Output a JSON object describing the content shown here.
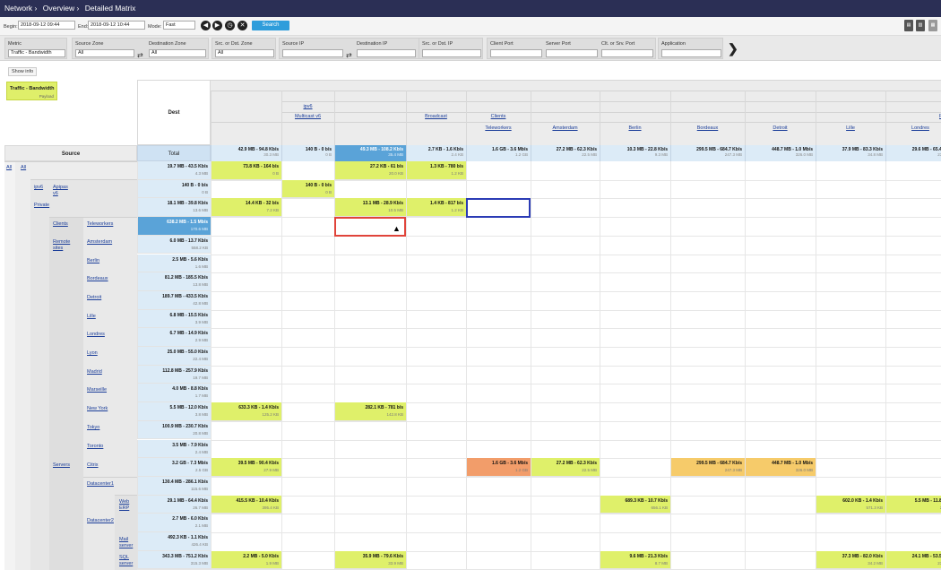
{
  "topbar": {
    "crumbs": [
      "Network ›",
      "Overview ›",
      "Detailed Matrix"
    ]
  },
  "filters": {
    "begin_label": "Begin:",
    "begin": "2018-09-12 09:44",
    "end_label": "End:",
    "end": "2018-09-12 10:44",
    "mode_label": "Mode:",
    "mode": "Fast",
    "search": "Search"
  },
  "facets": [
    {
      "title": "Metric",
      "value": "Traffic - Bandwidth"
    },
    {
      "title": "Source Zone",
      "value": "All"
    },
    {
      "title": "Destination Zone",
      "value": "All"
    },
    {
      "title": "Src. or Dst. Zone",
      "value": "All"
    },
    {
      "title": "Source IP",
      "value": ""
    },
    {
      "title": "Destination IP",
      "value": ""
    },
    {
      "title": "Src. or Dst. IP",
      "value": ""
    },
    {
      "title": "Client Port",
      "value": ""
    },
    {
      "title": "Server Port",
      "value": ""
    },
    {
      "title": "Clt. or Srv. Port",
      "value": ""
    },
    {
      "title": "Application",
      "value": ""
    }
  ],
  "show_info": "Show info",
  "legend": {
    "title": "Traffic - Bandwidth",
    "sub": "Payload"
  },
  "labels": {
    "dest": "Dest",
    "source": "Source",
    "total": "Total"
  },
  "dest_groups": {
    "ipv6": "ipv6",
    "multicast": "Multicast v6",
    "broadcast": "Broadcast",
    "clients": "Clients",
    "r": "R"
  },
  "columns": [
    "Teleworkers",
    "Amsterdam",
    "Berlin",
    "Bordeaux",
    "Detroit",
    "Lille",
    "Londres"
  ],
  "col_totals": [
    {
      "v": "42.9 MB - 94.8 Kb/s",
      "g": "30.3 MB"
    },
    {
      "v": "140 B - 0 b/s",
      "g": "0 B"
    },
    {
      "v": "49.3 MB - 108.2 Kb/s",
      "g": "35.4 MB"
    },
    {
      "v": "2.7 KB - 1.6 Kb/s",
      "g": "2.4 KB"
    },
    {
      "v": "1.6 GB - 3.6 Mb/s",
      "g": "1.2 GB"
    },
    {
      "v": "27.2 MB - 62.3 Kb/s",
      "g": "22.5 MB"
    },
    {
      "v": "10.3 MB - 22.8 Kb/s",
      "g": "9.3 MB"
    },
    {
      "v": "299.5 MB - 684.7 Kb/s",
      "g": "247.3 MB"
    },
    {
      "v": "448.7 MB - 1.0 Mb/s",
      "g": "326.0 MB"
    },
    {
      "v": "37.9 MB - 83.3 Kb/s",
      "g": "34.8 MB"
    },
    {
      "v": "29.6 MB - 65.4 Kb/s",
      "g": "23.9 MB"
    }
  ],
  "src_labels": {
    "all1": "All",
    "all2": "All",
    "ipv6": "ipv6",
    "apipa": "Apipas v6",
    "private": "Private",
    "clients": "Clients",
    "teleworkers": "Teleworkers",
    "remote": "Remote sites",
    "servers": "Servers",
    "citrix": "Citrix",
    "dc1": "Datacenter1",
    "web": "Web ERP",
    "dc2": "Datacenter2",
    "mail": "Mail server",
    "sql": "SQL server"
  },
  "rows": [
    {
      "name": "",
      "total": {
        "v": "19.7 MB - 43.5 Kb/s",
        "g": "4.3 MB"
      }
    },
    {
      "name": "",
      "total": {
        "v": "140 B - 0 b/s",
        "g": "0 B"
      }
    },
    {
      "name": "",
      "total": {
        "v": "18.1 MB - 39.8 Kb/s",
        "g": "13.6 MB"
      }
    },
    {
      "name": "",
      "total": {
        "v": "638.2 MB - 1.5 Mb/s",
        "g": "170.6 MB"
      }
    },
    {
      "name": "Amsterdam",
      "total": {
        "v": "6.0 MB - 13.7 Kb/s",
        "g": "558.2 KB"
      }
    },
    {
      "name": "Berlin",
      "total": {
        "v": "2.5 MB - 5.6 Kb/s",
        "g": "1.6 MB"
      }
    },
    {
      "name": "Bordeaux",
      "total": {
        "v": "81.2 MB - 185.5 Kb/s",
        "g": "13.8 MB"
      }
    },
    {
      "name": "Detroit",
      "total": {
        "v": "189.7 MB - 433.5 Kb/s",
        "g": "42.8 MB"
      }
    },
    {
      "name": "Lille",
      "total": {
        "v": "6.8 MB - 15.5 Kb/s",
        "g": "3.9 MB"
      }
    },
    {
      "name": "Londres",
      "total": {
        "v": "6.7 MB - 14.9 Kb/s",
        "g": "2.9 MB"
      }
    },
    {
      "name": "Lyon",
      "total": {
        "v": "25.0 MB - 55.0 Kb/s",
        "g": "22.4 MB"
      }
    },
    {
      "name": "Madrid",
      "total": {
        "v": "112.8 MB - 257.9 Kb/s",
        "g": "19.7 MB"
      }
    },
    {
      "name": "Marseille",
      "total": {
        "v": "4.0 MB - 8.8 Kb/s",
        "g": "1.7 MB"
      }
    },
    {
      "name": "New York",
      "total": {
        "v": "5.5 MB - 12.0 Kb/s",
        "g": "3.8 MB"
      }
    },
    {
      "name": "Tokyo",
      "total": {
        "v": "100.9 MB - 230.7 Kb/s",
        "g": "20.8 MB"
      }
    },
    {
      "name": "Toronto",
      "total": {
        "v": "3.5 MB - 7.9 Kb/s",
        "g": "2.4 MB"
      }
    },
    {
      "name": "",
      "total": {
        "v": "3.2 GB - 7.3 Mb/s",
        "g": "2.5 GB"
      }
    },
    {
      "name": "",
      "total": {
        "v": "130.4 MB - 286.1 Kb/s",
        "g": "115.6 MB"
      }
    },
    {
      "name": "",
      "total": {
        "v": "29.1 MB - 64.4 Kb/s",
        "g": "26.7 MB"
      }
    },
    {
      "name": "",
      "total": {
        "v": "2.7 MB - 6.0 Kb/s",
        "g": "2.1 MB"
      }
    },
    {
      "name": "",
      "total": {
        "v": "492.3 KB - 1.1 Kb/s",
        "g": "426.4 KB"
      }
    },
    {
      "name": "",
      "total": {
        "v": "343.3 MB - 751.2 Kb/s",
        "g": "315.3 MB"
      }
    }
  ],
  "cells": [
    {
      "r": 0,
      "c": 0,
      "v": "73.8 KB - 164 b/s",
      "g": "0 B"
    },
    {
      "r": 0,
      "c": 2,
      "v": "27.2 KB - 61 b/s",
      "g": "20.0 KB"
    },
    {
      "r": 0,
      "c": 3,
      "v": "1.3 KB - 780 b/s",
      "g": "1.2 KB"
    },
    {
      "r": 1,
      "c": 1,
      "v": "140 B - 0 b/s",
      "g": "0 B"
    },
    {
      "r": 2,
      "c": 0,
      "v": "14.4 KB - 32 b/s",
      "g": "7.2 KB"
    },
    {
      "r": 2,
      "c": 2,
      "v": "13.1 MB - 28.9 Kb/s",
      "g": "10.5 MB"
    },
    {
      "r": 2,
      "c": 3,
      "v": "1.4 KB - 817 b/s",
      "g": "1.2 KB"
    },
    {
      "r": 13,
      "c": 0,
      "v": "633.3 KB - 1.4 Kb/s",
      "g": "125.2 KB"
    },
    {
      "r": 13,
      "c": 2,
      "v": "282.1 KB - 781 b/s",
      "g": "142.8 KB"
    },
    {
      "r": 16,
      "c": 0,
      "v": "39.5 MB - 90.4 Kb/s",
      "g": "27.9 MB"
    },
    {
      "r": 16,
      "c": 4,
      "v": "1.6 GB - 3.6 Mb/s",
      "g": "1.2 GB"
    },
    {
      "r": 16,
      "c": 5,
      "v": "27.2 MB - 62.3 Kb/s",
      "g": "22.5 MB"
    },
    {
      "r": 16,
      "c": 7,
      "v": "299.5 MB - 684.7 Kb/s",
      "g": "247.3 MB"
    },
    {
      "r": 16,
      "c": 8,
      "v": "448.7 MB - 1.0 Mb/s",
      "g": "326.0 MB"
    },
    {
      "r": 18,
      "c": 0,
      "v": "415.5 KB - 10.4 Kb/s",
      "g": "395.4 KB"
    },
    {
      "r": 18,
      "c": 6,
      "v": "689.3 KB - 10.7 Kb/s",
      "g": "656.1 KB"
    },
    {
      "r": 18,
      "c": 9,
      "v": "602.0 KB - 1.4 Kb/s",
      "g": "571.3 KB"
    },
    {
      "r": 18,
      "c": 10,
      "v": "5.5 MB - 11.8 Kb/s",
      "g": "2.1 MB"
    },
    {
      "r": 21,
      "c": 0,
      "v": "2.2 MB - 5.0 Kb/s",
      "g": "1.9 MB"
    },
    {
      "r": 21,
      "c": 2,
      "v": "35.9 MB - 79.6 Kb/s",
      "g": "33.9 MB"
    },
    {
      "r": 21,
      "c": 6,
      "v": "9.6 MB - 21.3 Kb/s",
      "g": "8.7 MB"
    },
    {
      "r": 21,
      "c": 9,
      "v": "37.3 MB - 82.0 Kb/s",
      "g": "34.2 MB"
    },
    {
      "r": 21,
      "c": 10,
      "v": "24.1 MB - 53.5 Kb/s",
      "g": "23.9 MB"
    }
  ],
  "colors": {
    "green": "#dff06a",
    "orange": "#f29d6a",
    "amber": "#f6cb6a",
    "blue": "#5aa3d8",
    "lightblue": "#dcebf7",
    "topbar": "#2b2f55"
  }
}
